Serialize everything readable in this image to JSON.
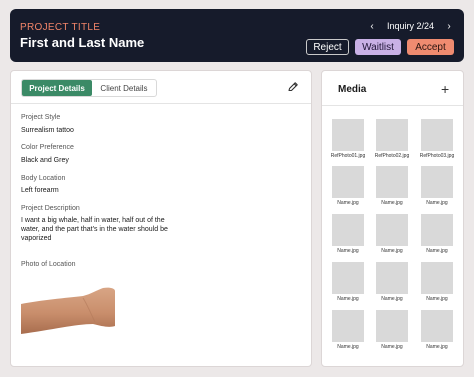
{
  "header": {
    "project_label": "PROJECT TITLE",
    "client_name": "First and Last Name",
    "inquiry": "Inquiry 2/24",
    "prev_icon": "chevron-left-icon",
    "next_icon": "chevron-right-icon",
    "reject_label": "Reject",
    "waitlist_label": "Waitlist",
    "accept_label": "Accept"
  },
  "details": {
    "tabs": [
      "Project Details",
      "Client Details"
    ],
    "active_tab": "Project Details",
    "edit_icon": "pencil-icon",
    "fields": [
      {
        "label": "Project Style",
        "value": "Surrealism tattoo"
      },
      {
        "label": "Color Preference",
        "value": "Black and Grey"
      },
      {
        "label": "Body Location",
        "value": "Left forearm"
      },
      {
        "label": "Project Description",
        "value": "I want a big whale, half in water, half out of the water, and the part that's in the water should be vaporized"
      }
    ],
    "photo_label": "Photo of Location"
  },
  "media": {
    "title": "Media",
    "add_icon": "plus-icon",
    "files": [
      "RefPhoto01.jpg",
      "RefPhoto02.jpg",
      "RefPhoto03.jpg",
      "Name.jpg",
      "Name.jpg",
      "Name.jpg",
      "Name.jpg",
      "Name.jpg",
      "Name.jpg",
      "Name.jpg",
      "Name.jpg",
      "Name.jpg",
      "Name.jpg",
      "Name.jpg",
      "Name.jpg"
    ]
  },
  "colors": {
    "header_bg": "#161b2b",
    "accent_orange": "#ef8b70",
    "waitlist_purple": "#c9b1e6",
    "tab_green": "#3b8a66"
  }
}
